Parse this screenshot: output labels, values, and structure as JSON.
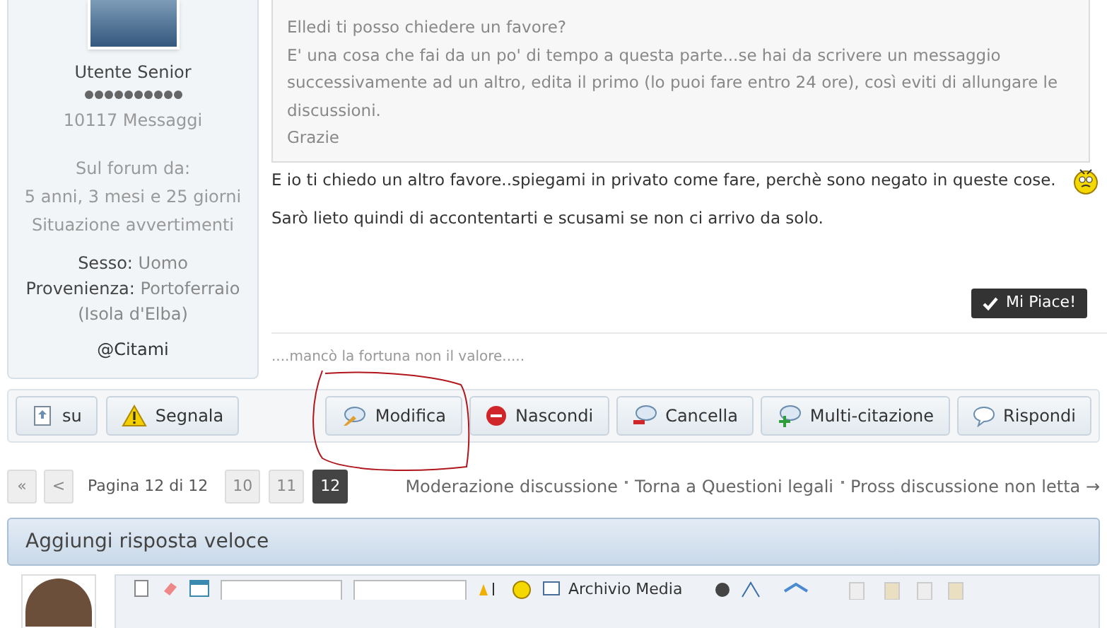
{
  "user_panel": {
    "rank": "Utente Senior",
    "reputation": {
      "stars": 10
    },
    "posts": "10117 Messaggi",
    "member_since_label": "Sul forum da:",
    "member_since": "5 anni, 3 mesi e 25 giorni",
    "warnings": "Situazione avvertimenti",
    "fields": [
      {
        "label": "Sesso:",
        "value": "Uomo"
      },
      {
        "label": "Provenienza:",
        "value": "Portoferraio (Isola d'Elba)"
      }
    ],
    "mention": "@Citami"
  },
  "post": {
    "quote_lines": [
      "Elledi ti posso chiedere un favore?",
      "E' una cosa che fai da un po' di tempo a questa parte...se hai da scrivere un messaggio successivamente ad un altro, edita il primo (lo puoi fare entro 24 ore), così eviti di allungare le discussioni.",
      "Grazie"
    ],
    "body_lines": [
      "E io ti chiedo un altro favore..spiegami in privato come fare, perchè sono negato in queste cose.",
      "Sarò lieto quindi di accontentarti e scusami se non ci arrivo da solo."
    ],
    "like_button": "Mi Piace!",
    "signature": "....mancò la fortuna non il valore....."
  },
  "actions_left": [
    {
      "kind": "up",
      "label": "su"
    },
    {
      "kind": "report",
      "label": "Segnala"
    }
  ],
  "actions_right": [
    {
      "kind": "edit",
      "label": "Modifica",
      "circled": true
    },
    {
      "kind": "hide",
      "label": "Nascondi",
      "circled": false
    },
    {
      "kind": "delete",
      "label": "Cancella",
      "circled": false
    },
    {
      "kind": "multiquote",
      "label": "Multi-citazione",
      "circled": false
    },
    {
      "kind": "reply",
      "label": "Rispondi",
      "circled": false
    }
  ],
  "pagination": {
    "first": "«",
    "prev": "<",
    "info": "Pagina 12 di 12",
    "pages": [
      {
        "label": "10",
        "selected": false
      },
      {
        "label": "11",
        "selected": false
      },
      {
        "label": "12",
        "selected": true
      }
    ]
  },
  "thread_links": [
    "Moderazione discussione",
    "Torna a Questioni legali",
    "Pross discussione non letta →"
  ],
  "quick_reply": {
    "title": "Aggiungi risposta veloce",
    "toolbar_media": "Archivio Media"
  }
}
